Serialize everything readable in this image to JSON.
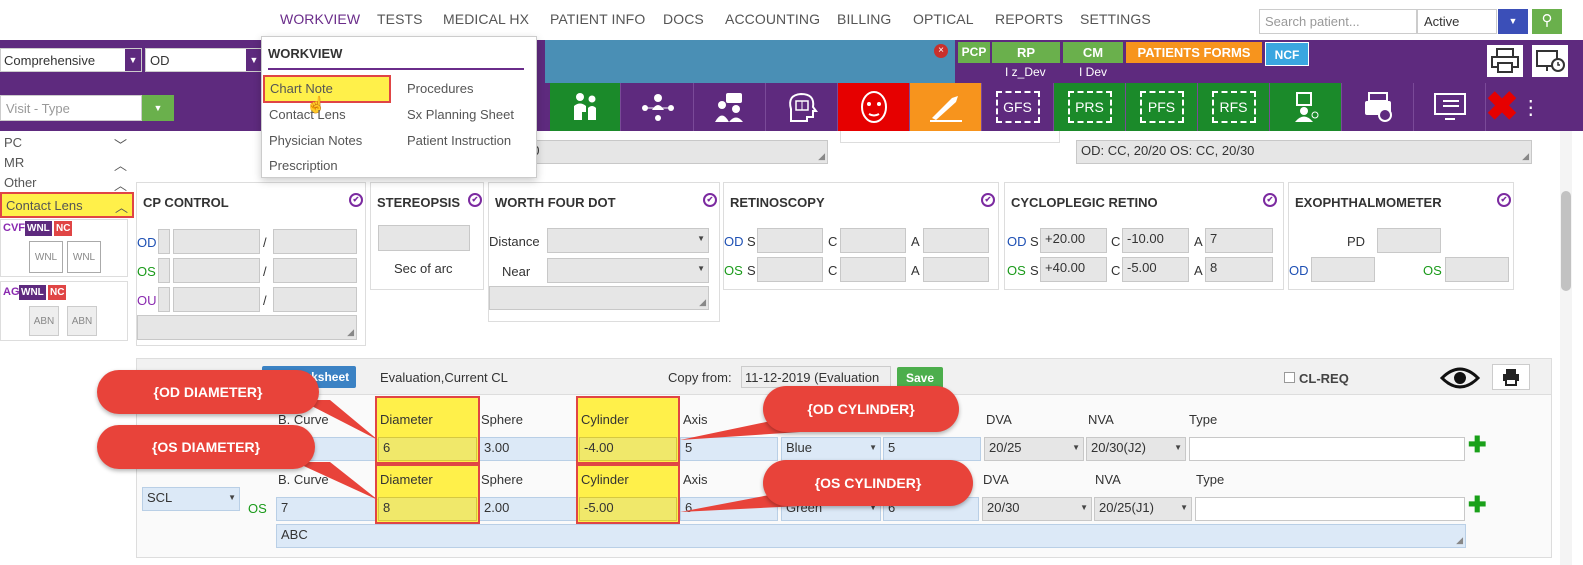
{
  "nav": {
    "items": [
      "WORKVIEW",
      "TESTS",
      "MEDICAL HX",
      "PATIENT INFO",
      "DOCS",
      "ACCOUNTING",
      "BILLING",
      "OPTICAL",
      "REPORTS",
      "SETTINGS"
    ],
    "search_placeholder": "Search patient...",
    "status_value": "Active"
  },
  "toolbar": {
    "exam_type": "Comprehensive",
    "eye": "OD",
    "visit_type_placeholder": "Visit - Type",
    "badges": [
      "PCP",
      "RP",
      "CM",
      "PATIENTS FORMS",
      "NCF"
    ],
    "badge_subs": [
      "I z_Dev",
      "I Dev"
    ],
    "sq_buttons": [
      "GFS",
      "PRS",
      "PFS",
      "RFS"
    ]
  },
  "dropdown": {
    "header": "WORKVIEW",
    "col1": [
      "Chart Note",
      "Contact Lens",
      "Physician Notes",
      "Prescription"
    ],
    "col2": [
      "Procedures",
      "Sx Planning Sheet",
      "Patient Instruction"
    ]
  },
  "sidebar": {
    "items": [
      "PC",
      "MR",
      "Other",
      "Contact Lens"
    ],
    "cvf": "CVF",
    "ag": "AG",
    "wnl": "WNL",
    "nc": "NC",
    "abn": "ABN"
  },
  "top_fields": {
    "left_partial": "30",
    "right_text": "OD: CC, 20/20 OS: CC, 20/30"
  },
  "panels": {
    "cp_control": {
      "title": "CP CONTROL",
      "labels": [
        "OD",
        "OS",
        "OU"
      ],
      "sep": "/"
    },
    "stereopsis": {
      "title": "STEREOPSIS",
      "unit": "Sec of arc"
    },
    "worth_four_dot": {
      "title": "WORTH FOUR DOT",
      "distance": "Distance",
      "near": "Near"
    },
    "retinoscopy": {
      "title": "RETINOSCOPY",
      "od": "OD",
      "os": "OS",
      "s": "S",
      "c": "C",
      "a": "A"
    },
    "cyclo": {
      "title": "CYCLOPLEGIC RETINO",
      "od": "OD",
      "os": "OS",
      "s": "S",
      "c": "C",
      "a": "A",
      "od_s": "+20.00",
      "od_c": "-10.00",
      "od_a": "7",
      "os_s": "+40.00",
      "os_c": "-5.00",
      "os_a": "8"
    },
    "exophthalmometer": {
      "title": "EXOPHTHALMOMETER",
      "pd": "PD",
      "od": "OD",
      "os": "OS"
    }
  },
  "cl": {
    "worksheet_btn": "Worksheet",
    "evaluation": "Evaluation,Current CL",
    "copy_from_label": "Copy from:",
    "copy_from_value": "11-12-2019 (Evaluation",
    "save": "Save",
    "cl_req": "CL-REQ",
    "headers": [
      "B. Curve",
      "Diameter",
      "Sphere",
      "Cylinder",
      "Axis",
      "DVA",
      "NVA",
      "Type"
    ],
    "od": {
      "diameter": "6",
      "sphere": "3.00",
      "cylinder": "-4.00",
      "axis": "5",
      "color": "Blue",
      "add": "5",
      "dva": "20/25",
      "nva": "20/30(J2)"
    },
    "os": {
      "lens_type": "SCL",
      "label": "OS",
      "bcurve": "7",
      "diameter": "8",
      "sphere": "2.00",
      "cylinder": "-5.00",
      "axis": "6",
      "color": "Green",
      "add": "6",
      "dva": "20/30",
      "nva": "20/25(J1)"
    },
    "comment": "ABC"
  },
  "callouts": {
    "od_diameter": "{OD DIAMETER}",
    "os_diameter": "{OS DIAMETER}",
    "od_cylinder": "{OD CYLINDER}",
    "os_cylinder": "{OS CYLINDER}"
  },
  "colors": {
    "purple": "#5e2a7e",
    "green": "#1b8a2a",
    "red": "#e60000",
    "orange": "#f7941d",
    "highlight": "#fff04a",
    "callout": "#e8433a"
  }
}
